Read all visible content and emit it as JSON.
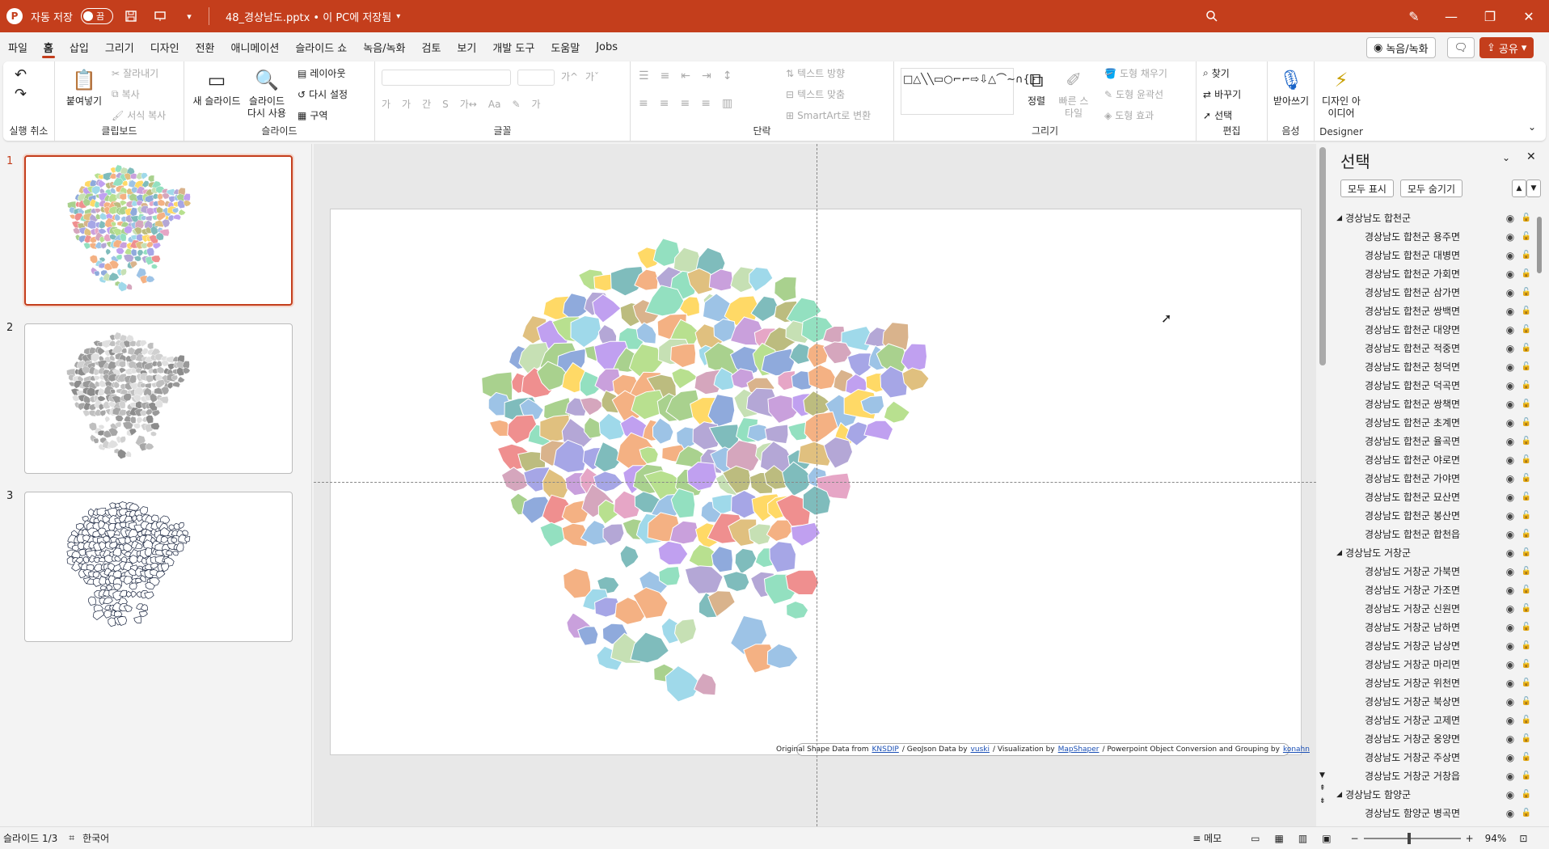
{
  "titlebar": {
    "autosave_label": "자동 저장",
    "autosave_state": "끔",
    "file_title": "48_경상남도.pptx • 이 PC에 저장됨"
  },
  "menu": [
    "파일",
    "홈",
    "삽입",
    "그리기",
    "디자인",
    "전환",
    "애니메이션",
    "슬라이드 쇼",
    "녹음/녹화",
    "검토",
    "보기",
    "개발 도구",
    "도움말",
    "Jobs"
  ],
  "menu_active": "홈",
  "topright": {
    "record": "녹음/녹화",
    "share": "공유"
  },
  "ribbon": {
    "undo_group": "실행 취소",
    "clipboard": {
      "paste": "붙여넣기",
      "cut": "잘라내기",
      "copy": "복사",
      "format_painter": "서식 복사",
      "label": "클립보드"
    },
    "slides": {
      "new_slide": "새 슬라이드",
      "reuse": "슬라이드 다시 사용",
      "layout": "레이아웃",
      "reset": "다시 설정",
      "section": "구역",
      "label": "슬라이드"
    },
    "font": {
      "label": "글꼴",
      "grow": "가^",
      "shrink": "가ˇ",
      "bold": "가",
      "italic": "가",
      "underline": "간",
      "strike": "S",
      "spacing": "가↔",
      "case": "Aa",
      "clear": "가"
    },
    "paragraph": {
      "label": "단락",
      "text_direction": "텍스트 방향",
      "align_text": "텍스트 맞춤",
      "smartart": "SmartArt로 변환"
    },
    "drawing": {
      "label": "그리기",
      "arrange": "정렬",
      "quick_styles": "빠른 스타일",
      "fill": "도형 채우기",
      "outline": "도형 윤곽선",
      "effects": "도형 효과"
    },
    "editing": {
      "label": "편집",
      "find": "찾기",
      "replace": "바꾸기",
      "select": "선택"
    },
    "voice": {
      "label": "음성",
      "dictate": "받아쓰기"
    },
    "designer": {
      "label": "Designer",
      "ideas": "디자인 아이디어"
    }
  },
  "slides": [
    {
      "num": "1"
    },
    {
      "num": "2"
    },
    {
      "num": "3"
    }
  ],
  "credit": {
    "a": "Original Shape Data from",
    "l1": "KNSDIP",
    "b": "/ GeoJson Data by",
    "l2": "vuski",
    "c": "/ Visualization  by",
    "l3": "MapShaper",
    "d": "/ Powerpoint Object Conversion and Grouping  by",
    "l4": "konahn"
  },
  "selection": {
    "title": "선택",
    "show_all": "모두 표시",
    "hide_all": "모두 숨기기",
    "rows": [
      {
        "t": "group",
        "name": "경상남도 합천군"
      },
      {
        "t": "item",
        "name": "경상남도 합천군 용주면"
      },
      {
        "t": "item",
        "name": "경상남도 합천군 대병면"
      },
      {
        "t": "item",
        "name": "경상남도 합천군 가회면"
      },
      {
        "t": "item",
        "name": "경상남도 합천군 삼가면"
      },
      {
        "t": "item",
        "name": "경상남도 합천군 쌍백면"
      },
      {
        "t": "item",
        "name": "경상남도 합천군 대양면"
      },
      {
        "t": "item",
        "name": "경상남도 합천군 적중면"
      },
      {
        "t": "item",
        "name": "경상남도 합천군 청덕면"
      },
      {
        "t": "item",
        "name": "경상남도 합천군 덕곡면"
      },
      {
        "t": "item",
        "name": "경상남도 합천군 쌍책면"
      },
      {
        "t": "item",
        "name": "경상남도 합천군 초계면"
      },
      {
        "t": "item",
        "name": "경상남도 합천군 율곡면"
      },
      {
        "t": "item",
        "name": "경상남도 합천군 야로면"
      },
      {
        "t": "item",
        "name": "경상남도 합천군 가야면"
      },
      {
        "t": "item",
        "name": "경상남도 합천군 묘산면"
      },
      {
        "t": "item",
        "name": "경상남도 합천군 봉산면"
      },
      {
        "t": "item",
        "name": "경상남도 합천군 합천읍"
      },
      {
        "t": "group",
        "name": "경상남도 거창군"
      },
      {
        "t": "item",
        "name": "경상남도 거창군 가북면"
      },
      {
        "t": "item",
        "name": "경상남도 거창군 가조면"
      },
      {
        "t": "item",
        "name": "경상남도 거창군 신원면"
      },
      {
        "t": "item",
        "name": "경상남도 거창군 남하면"
      },
      {
        "t": "item",
        "name": "경상남도 거창군 남상면"
      },
      {
        "t": "item",
        "name": "경상남도 거창군 마리면"
      },
      {
        "t": "item",
        "name": "경상남도 거창군 위천면"
      },
      {
        "t": "item",
        "name": "경상남도 거창군 북상면"
      },
      {
        "t": "item",
        "name": "경상남도 거창군 고제면"
      },
      {
        "t": "item",
        "name": "경상남도 거창군 웅양면"
      },
      {
        "t": "item",
        "name": "경상남도 거창군 주상면"
      },
      {
        "t": "item",
        "name": "경상남도 거창군 거창읍"
      },
      {
        "t": "group",
        "name": "경상남도 함양군"
      },
      {
        "t": "item",
        "name": "경상남도 함양군 병곡면"
      }
    ]
  },
  "status": {
    "slide": "슬라이드 1/3",
    "lang": "한국어",
    "notes": "메모",
    "zoom": "94%"
  }
}
